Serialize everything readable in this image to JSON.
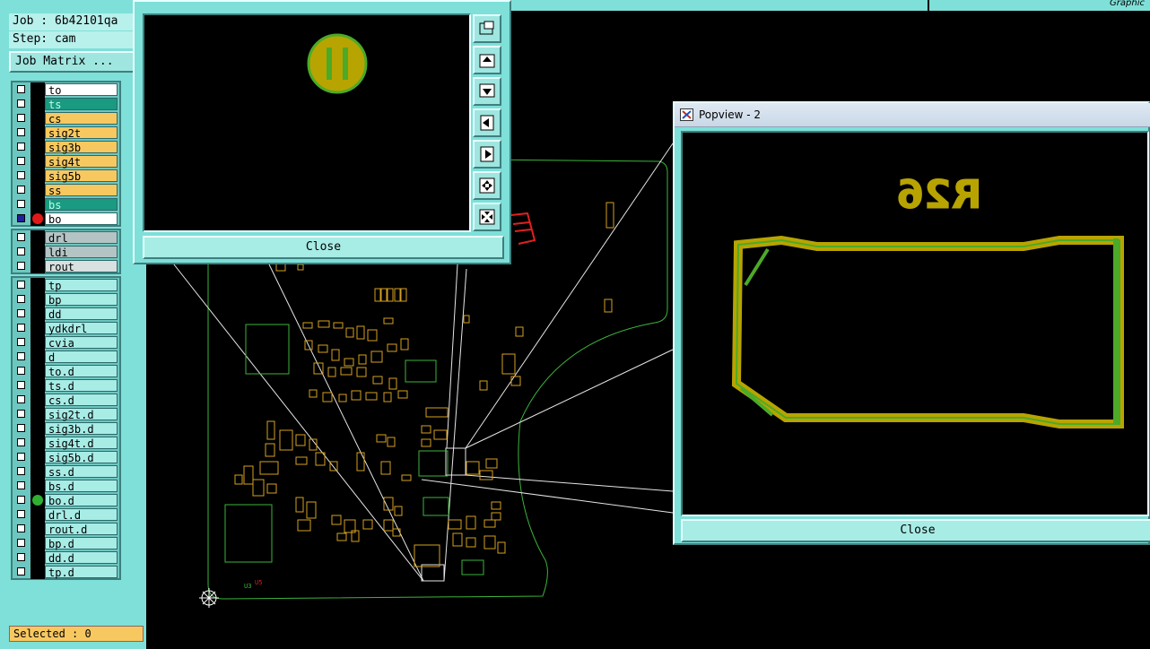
{
  "header": {
    "job_label": "Job : 6b42101qa",
    "step_label": "Step: cam",
    "job_matrix_button": "Job Matrix ...",
    "top_right_text": "Graphic"
  },
  "layer_groups": [
    {
      "layers": [
        {
          "name": "to",
          "color": "#ffffff"
        },
        {
          "name": "ts",
          "color": "#1a9a80"
        },
        {
          "name": "cs",
          "color": "#f8c860"
        },
        {
          "name": "sig2t",
          "color": "#f8c860"
        },
        {
          "name": "sig3b",
          "color": "#f8c860"
        },
        {
          "name": "sig4t",
          "color": "#f8c860"
        },
        {
          "name": "sig5b",
          "color": "#f8c860"
        },
        {
          "name": "ss",
          "color": "#f8c860"
        },
        {
          "name": "bs",
          "color": "#1a9a80"
        },
        {
          "name": "bo",
          "color": "#ffffff",
          "affected": true,
          "work": true
        }
      ]
    },
    {
      "layers": [
        {
          "name": "drl",
          "color": "#b4c4c4"
        },
        {
          "name": "ldi",
          "color": "#b4c4c4"
        },
        {
          "name": "rout",
          "color": "#d8e0e0"
        }
      ]
    },
    {
      "layers": [
        {
          "name": "tp",
          "color": "#a8ece6"
        },
        {
          "name": "bp",
          "color": "#a8ece6"
        },
        {
          "name": "dd",
          "color": "#a8ece6"
        },
        {
          "name": "ydkdrl",
          "color": "#a8ece6"
        },
        {
          "name": "cvia",
          "color": "#a8ece6"
        },
        {
          "name": "d",
          "color": "#a8ece6"
        },
        {
          "name": "to.d",
          "color": "#a8ece6"
        },
        {
          "name": "ts.d",
          "color": "#a8ece6"
        },
        {
          "name": "cs.d",
          "color": "#a8ece6"
        },
        {
          "name": "sig2t.d",
          "color": "#a8ece6"
        },
        {
          "name": "sig3b.d",
          "color": "#a8ece6"
        },
        {
          "name": "sig4t.d",
          "color": "#a8ece6"
        },
        {
          "name": "sig5b.d",
          "color": "#a8ece6"
        },
        {
          "name": "ss.d",
          "color": "#a8ece6"
        },
        {
          "name": "bs.d",
          "color": "#a8ece6"
        },
        {
          "name": "bo.d",
          "color": "#a8ece6",
          "green_marker": true
        },
        {
          "name": "drl.d",
          "color": "#a8ece6"
        },
        {
          "name": "rout.d",
          "color": "#a8ece6"
        },
        {
          "name": "bp.d",
          "color": "#a8ece6"
        },
        {
          "name": "dd.d",
          "color": "#a8ece6"
        },
        {
          "name": "tp.d",
          "color": "#a8ece6"
        }
      ]
    }
  ],
  "status": {
    "selected": "Selected : 0"
  },
  "popview1": {
    "close_label": "Close"
  },
  "popview2": {
    "title": "Popview - 2",
    "close_label": "Close",
    "silk_text": "R26"
  },
  "colors": {
    "panel": "#7ee0d8",
    "pad_fill": "#b8a400",
    "pad_outline": "#4caa28",
    "board_outline": "#3cb43c",
    "component": "#d4a020",
    "silk_red": "#e02020"
  }
}
